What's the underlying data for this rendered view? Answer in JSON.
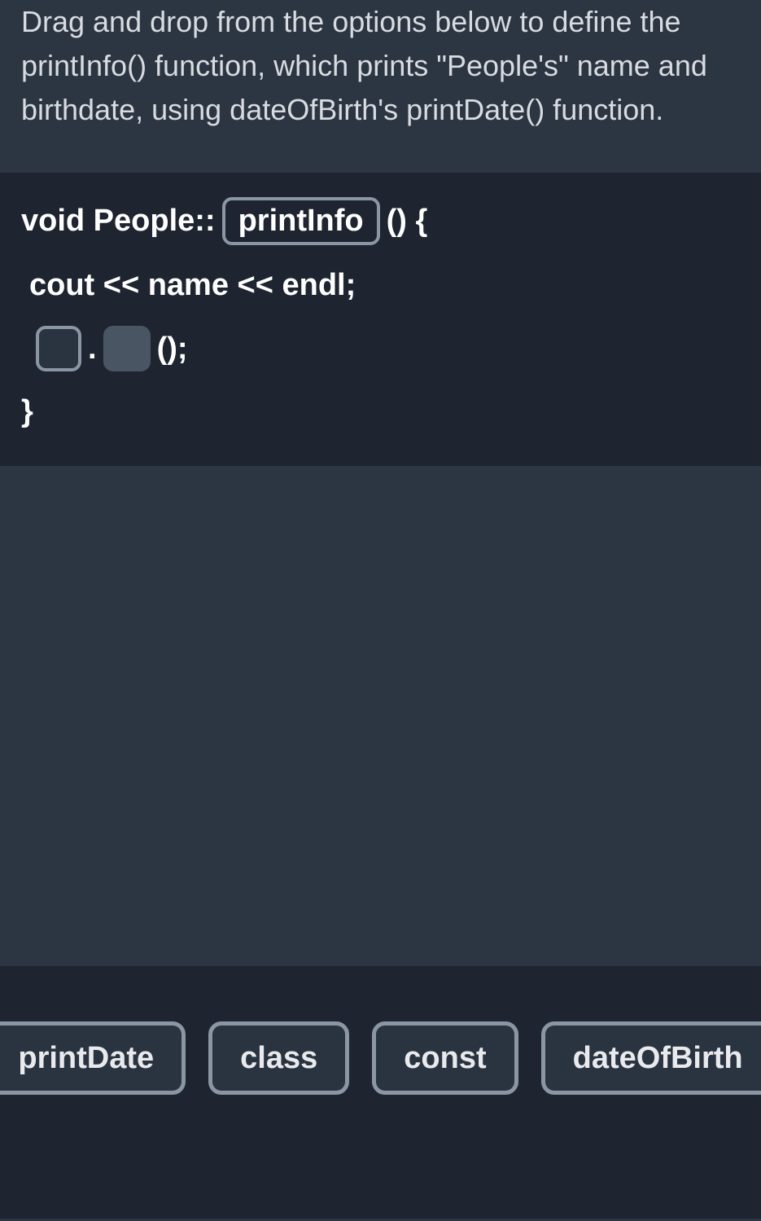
{
  "instructions": "Drag and drop from the options below to define the printInfo() function, which prints \"People's\" name and birthdate, using dateOfBirth's printDate() function.",
  "code": {
    "line1_prefix": "void People::",
    "line1_slot": "printInfo",
    "line1_suffix": "() {",
    "line2": "cout << name << endl;",
    "line3_dot": ".",
    "line3_suffix": "();",
    "line4": "}"
  },
  "tray": {
    "opt1": "printDate",
    "opt2": "class",
    "opt3": "const",
    "opt4": "dateOfBirth"
  }
}
